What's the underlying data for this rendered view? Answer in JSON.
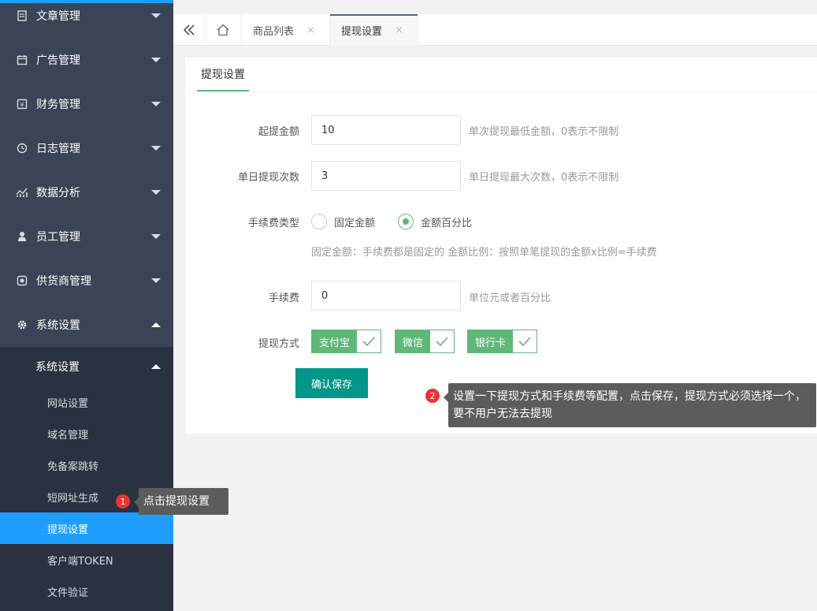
{
  "sidebar": {
    "menus": [
      {
        "label": "文章管理",
        "icon": "document-icon"
      },
      {
        "label": "广告管理",
        "icon": "calendar-icon"
      },
      {
        "label": "财务管理",
        "icon": "finance-icon"
      },
      {
        "label": "日志管理",
        "icon": "clock-icon"
      },
      {
        "label": "数据分析",
        "icon": "chart-icon"
      },
      {
        "label": "员工管理",
        "icon": "user-icon"
      },
      {
        "label": "供货商管理",
        "icon": "supplier-icon"
      },
      {
        "label": "系统设置",
        "icon": "gear-icon"
      }
    ],
    "submenu_title": "系统设置",
    "subitems": [
      "网站设置",
      "域名管理",
      "免备案跳转",
      "短网址生成",
      "提现设置",
      "客户端TOKEN",
      "文件验证"
    ]
  },
  "tabs": [
    {
      "label": "商品列表"
    },
    {
      "label": "提现设置"
    }
  ],
  "tab_close": "×",
  "card_tab": "提现设置",
  "form": {
    "min_amount_label": "起提金额",
    "min_amount_value": "10",
    "min_amount_hint": "单次提现最低金额，0表示不限制",
    "daily_times_label": "单日提现次数",
    "daily_times_value": "3",
    "daily_times_hint": "单日提现最大次数，0表示不限制",
    "fee_type_label": "手续费类型",
    "fee_type_options": [
      "固定金额",
      "金额百分比"
    ],
    "fee_type_hint": "固定金额：手续费都是固定的 金额比例：按照单笔提现的金额x比例=手续费",
    "fee_label": "手续费",
    "fee_value": "0",
    "fee_hint": "单位元或者百分比",
    "method_label": "提现方式",
    "methods": [
      "支付宝",
      "微信",
      "银行卡"
    ],
    "save_label": "确认保存"
  },
  "tips": {
    "tip1_num": "1",
    "tip1_text": "点击提现设置",
    "tip2_num": "2",
    "tip2_text": "设置一下提现方式和手续费等配置，点击保存，提现方式必须选择一个，要不用户无法去提现"
  },
  "colors": {
    "accent": "#1e9fff",
    "green": "#5fb878",
    "teal": "#009688",
    "sidebar": "#3a4456"
  }
}
